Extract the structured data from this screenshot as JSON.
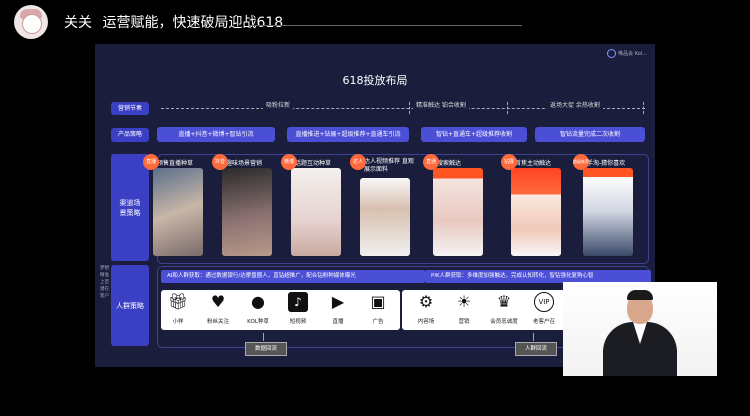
{
  "header": {
    "author": "关关",
    "title": "运营赋能，快速破局迎战618"
  },
  "slide": {
    "logo_text": "唯品会 Kol...",
    "title": "618投放布局",
    "row_labels": {
      "rhythm": "营销节奏",
      "product": "产品策略",
      "channel_line1": "渠道场",
      "channel_line2": "景策略",
      "crowd": "人群策略"
    },
    "timeline": [
      {
        "label": "吸粉拉新"
      },
      {
        "label": "精准触达  铂合收割"
      },
      {
        "label": "返场大促  余热收割"
      }
    ],
    "products": [
      "直播+抖音+微博+智钻引流",
      "直播推进+钻展+超级推荐+直通车引流",
      "智钻+直通车+超级推荐收割",
      "智钻流量完成二次收割"
    ],
    "channels": [
      {
        "badge": "直播",
        "caption": "预售直播种草"
      },
      {
        "badge": "抖音",
        "caption": "趣味场景营销"
      },
      {
        "badge": "微博",
        "caption": "话题互动种草"
      },
      {
        "badge": "达人",
        "caption": "达人视频推荐 直观展示面料"
      },
      {
        "badge": "直通",
        "caption": "搜索触达"
      },
      {
        "badge": "钻展",
        "caption": "首焦主动触达"
      },
      {
        "badge": "超级推荐",
        "caption": "手淘-猜你喜欢"
      }
    ],
    "crowd": {
      "bar_left": "AI和人群获取：通过数据银行/达摩盘圈人，直钻超推广，配合钻粉种媒体曝光",
      "bar_right": "PIK人群获取：多维度加强触达，完成认知转化，智钻强化复购心智",
      "icons_left": [
        {
          "icon": "gift-icon",
          "label": "小样"
        },
        {
          "icon": "hearts-icon",
          "label": "粉丝关注"
        },
        {
          "icon": "kol-icon",
          "label": "KOL种草"
        },
        {
          "icon": "tiktok-icon",
          "label": "短视频"
        },
        {
          "icon": "tv-icon",
          "label": "直播"
        },
        {
          "icon": "ad-icon",
          "label": "广告"
        }
      ],
      "icons_right": [
        {
          "icon": "gear-icon",
          "label": "内容场"
        },
        {
          "icon": "bulb-icon",
          "label": "营销"
        },
        {
          "icon": "crown-icon",
          "label": "会员忠诚度"
        },
        {
          "icon": "vip-icon",
          "label": "老客户召"
        }
      ],
      "pill_left": "数据回流",
      "pill_right": "人群回流"
    },
    "side_text": "梦想 精准 上百 潜在 客户"
  },
  "colors": {
    "background": "#000000",
    "slide_bg": "#1a1e3c",
    "accent_blue": "#4a4fd6",
    "badge_orange": "#ff6a3d"
  }
}
